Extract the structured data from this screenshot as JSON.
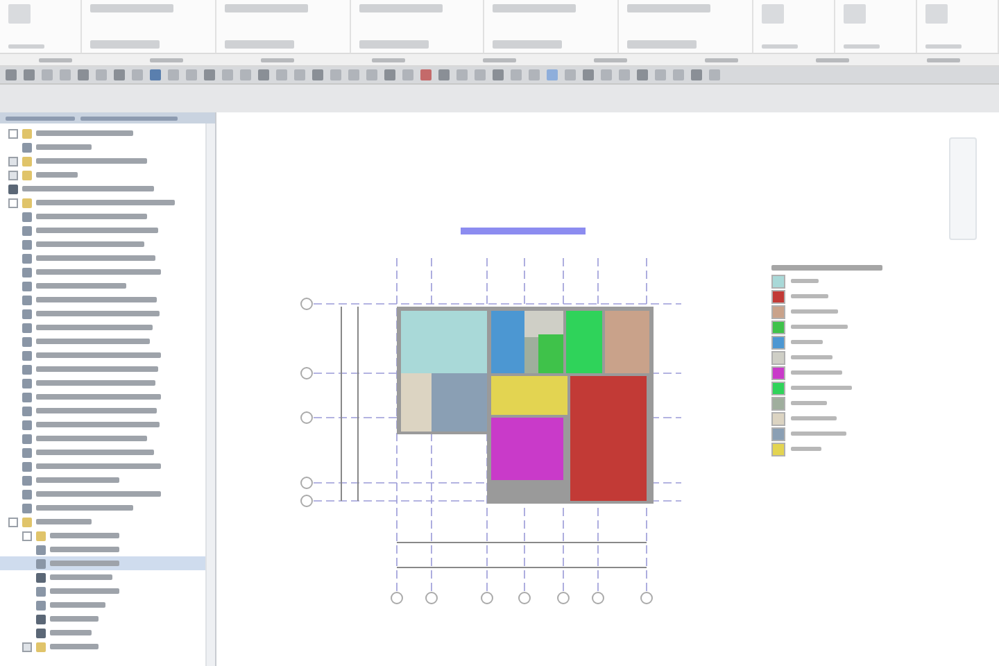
{
  "ribbon": {
    "groups": [
      {
        "kind": "large"
      },
      {
        "kind": "rows"
      },
      {
        "kind": "rows"
      },
      {
        "kind": "rows"
      },
      {
        "kind": "rows"
      },
      {
        "kind": "rows"
      },
      {
        "kind": "large"
      },
      {
        "kind": "large"
      },
      {
        "kind": "large"
      }
    ]
  },
  "toolbar": {
    "icons": [
      {
        "color": "#8a8f96"
      },
      {
        "color": "#8a8f96"
      },
      {
        "color": "#b0b4ba"
      },
      {
        "color": "#b0b4ba"
      },
      {
        "color": "#8a8f96"
      },
      {
        "color": "#b0b4ba"
      },
      {
        "color": "#8a8f96"
      },
      {
        "color": "#b0b4ba"
      },
      {
        "color": "#5a7fae"
      },
      {
        "color": "#b0b4ba"
      },
      {
        "color": "#b0b4ba"
      },
      {
        "color": "#8a8f96"
      },
      {
        "color": "#b0b4ba"
      },
      {
        "color": "#b0b4ba"
      },
      {
        "color": "#8a8f96"
      },
      {
        "color": "#b0b4ba"
      },
      {
        "color": "#b0b4ba"
      },
      {
        "color": "#8a8f96"
      },
      {
        "color": "#b0b4ba"
      },
      {
        "color": "#b0b4ba"
      },
      {
        "color": "#b0b4ba"
      },
      {
        "color": "#8a8f96"
      },
      {
        "color": "#b0b4ba"
      },
      {
        "color": "#c46a6a"
      },
      {
        "color": "#8a8f96"
      },
      {
        "color": "#b0b4ba"
      },
      {
        "color": "#b0b4ba"
      },
      {
        "color": "#8a8f96"
      },
      {
        "color": "#b0b4ba"
      },
      {
        "color": "#b0b4ba"
      },
      {
        "color": "#8eaedb"
      },
      {
        "color": "#b0b4ba"
      },
      {
        "color": "#8a8f96"
      },
      {
        "color": "#b0b4ba"
      },
      {
        "color": "#b0b4ba"
      },
      {
        "color": "#8a8f96"
      },
      {
        "color": "#b0b4ba"
      },
      {
        "color": "#b0b4ba"
      },
      {
        "color": "#8a8f96"
      },
      {
        "color": "#b0b4ba"
      }
    ]
  },
  "browser": {
    "items": [
      {
        "kind": "folder",
        "expanded": true,
        "selected": false,
        "children": [
          {
            "kind": "view",
            "selected": false
          }
        ]
      },
      {
        "kind": "folder",
        "expanded": false,
        "selected": false
      },
      {
        "kind": "folder",
        "expanded": false,
        "selected": false
      },
      {
        "kind": "sheet",
        "selected": false
      },
      {
        "kind": "folder",
        "expanded": true,
        "selected": false,
        "children": [
          {
            "kind": "view",
            "selected": false
          },
          {
            "kind": "view",
            "selected": false
          },
          {
            "kind": "view",
            "selected": false
          },
          {
            "kind": "view",
            "selected": false
          },
          {
            "kind": "view",
            "selected": false
          },
          {
            "kind": "view",
            "selected": false
          },
          {
            "kind": "view",
            "selected": false
          },
          {
            "kind": "view",
            "selected": false
          },
          {
            "kind": "view",
            "selected": false
          },
          {
            "kind": "view",
            "selected": false
          },
          {
            "kind": "view",
            "selected": false
          },
          {
            "kind": "view",
            "selected": false
          },
          {
            "kind": "view",
            "selected": false
          },
          {
            "kind": "view",
            "selected": false
          },
          {
            "kind": "view",
            "selected": false
          },
          {
            "kind": "view",
            "selected": false
          },
          {
            "kind": "view",
            "selected": false
          },
          {
            "kind": "view",
            "selected": false
          },
          {
            "kind": "view",
            "selected": false
          },
          {
            "kind": "view",
            "selected": false
          },
          {
            "kind": "view",
            "selected": false
          },
          {
            "kind": "view",
            "selected": false
          }
        ]
      },
      {
        "kind": "folder",
        "expanded": true,
        "selected": false,
        "children": [
          {
            "kind": "folder",
            "expanded": true,
            "selected": false,
            "children": [
              {
                "kind": "view",
                "selected": false
              },
              {
                "kind": "view",
                "selected": true
              },
              {
                "kind": "sheet",
                "selected": false
              },
              {
                "kind": "view",
                "selected": false
              },
              {
                "kind": "view",
                "selected": false
              },
              {
                "kind": "sheet",
                "selected": false
              },
              {
                "kind": "sheet",
                "selected": false
              }
            ]
          },
          {
            "kind": "folder",
            "expanded": false,
            "selected": false
          }
        ]
      }
    ]
  },
  "legend": {
    "items": [
      {
        "color": "#a9d9d8"
      },
      {
        "color": "#c23a36"
      },
      {
        "color": "#c9a28a"
      },
      {
        "color": "#3fc24a"
      },
      {
        "color": "#4c97d2"
      },
      {
        "color": "#cfcfc6"
      },
      {
        "color": "#c93ac9"
      },
      {
        "color": "#2fd35a"
      },
      {
        "color": "#9fae9d"
      },
      {
        "color": "#dcd4c2"
      },
      {
        "color": "#8a9fb4"
      },
      {
        "color": "#e3d451"
      }
    ]
  }
}
